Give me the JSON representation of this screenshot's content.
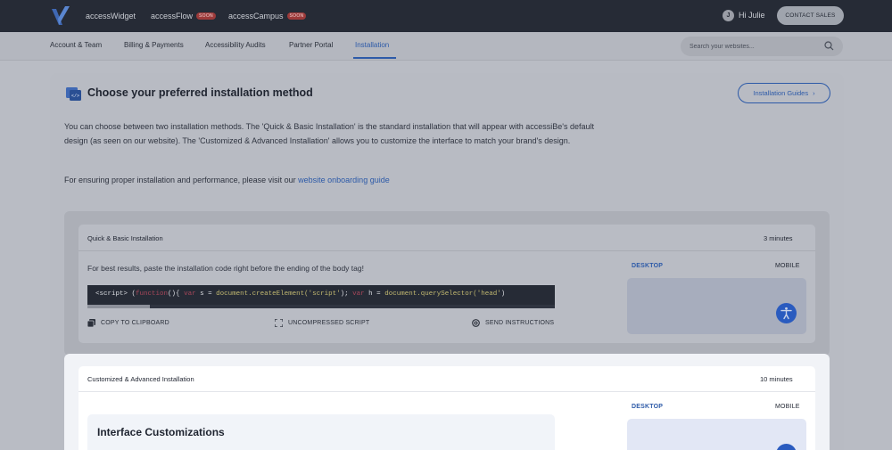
{
  "topbar": {
    "logo": "accessibe-logo-icon",
    "links": [
      {
        "label": "accessWidget",
        "badge": ""
      },
      {
        "label": "accessFlow",
        "badge": "SOON"
      },
      {
        "label": "accessCampus",
        "badge": "SOON"
      }
    ],
    "user_initial": "J",
    "greeting": "Hi Julie",
    "contact_label": "CONTACT SALES"
  },
  "subnav": {
    "items": [
      "Account & Team",
      "Billing & Payments",
      "Accessibility Audits",
      "Partner Portal",
      "Installation"
    ],
    "active": "Installation",
    "search_placeholder": "Search your websites..."
  },
  "main": {
    "title": "Choose your preferred installation method",
    "guides_button": "Installation Guides",
    "description": "You can choose between two installation methods. The 'Quick & Basic Installation' is the standard installation that will appear with accessiBe's default design (as seen on our website). The 'Customized & Advanced Installation' allows you to customize the interface to match your brand's design.",
    "onboarding_prefix": "For ensuring proper installation and performance, please visit our ",
    "onboarding_link": "website onboarding guide"
  },
  "quick": {
    "title": "Quick & Basic Installation",
    "time": "3 minutes",
    "hint": "For best results, paste the installation code right before the ending of the body tag!",
    "code": {
      "tag": "<script>",
      "open": " (",
      "kw_function": "function",
      "after_function": "(){ ",
      "kw_var1": "var",
      "s_decl": " s = ",
      "fn_create": "document.createElement(",
      "str_script": "'script'",
      "close1": "); ",
      "kw_var2": "var",
      "h_decl": " h = ",
      "fn_query": "document.querySelector(",
      "str_head": "'head'",
      "close2": ")"
    },
    "actions": [
      {
        "label": "COPY TO CLIPBOARD",
        "icon": "copy-icon"
      },
      {
        "label": "UNCOMPRESSED SCRIPT",
        "icon": "expand-icon"
      },
      {
        "label": "SEND INSTRUCTIONS",
        "icon": "at-icon"
      }
    ],
    "tab_desktop": "DESKTOP",
    "tab_mobile": "MOBILE"
  },
  "custom": {
    "title": "Customized & Advanced Installation",
    "time": "10 minutes",
    "interface_title": "Interface Customizations",
    "tab_desktop": "DESKTOP",
    "tab_mobile": "MOBILE"
  },
  "colors": {
    "accent": "#2d5aa8",
    "topbar": "#262b36",
    "widget_button": "#2a5bbf"
  }
}
